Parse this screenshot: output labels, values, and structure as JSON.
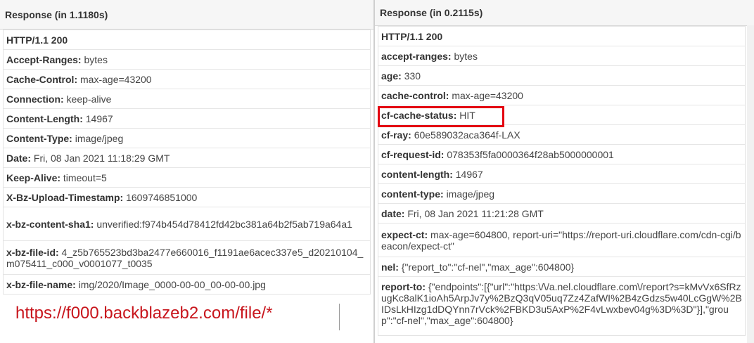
{
  "left": {
    "title": "Response (in 1.1180s)",
    "status": "HTTP/1.1 200",
    "headers": [
      {
        "key": "Accept-Ranges:",
        "value": "bytes"
      },
      {
        "key": "Cache-Control:",
        "value": "max-age=43200"
      },
      {
        "key": "Connection:",
        "value": "keep-alive"
      },
      {
        "key": "Content-Length:",
        "value": "14967"
      },
      {
        "key": "Content-Type:",
        "value": "image/jpeg"
      },
      {
        "key": "Date:",
        "value": "Fri, 08 Jan 2021 11:18:29 GMT"
      },
      {
        "key": "Keep-Alive:",
        "value": "timeout=5"
      },
      {
        "key": "X-Bz-Upload-Timestamp:",
        "value": "1609746851000"
      },
      {
        "key": "x-bz-content-sha1:",
        "value": "unverified:f974b454d78412fd42bc381a64b2f5ab719a64a1"
      },
      {
        "key": "x-bz-file-id:",
        "value": "4_z5b765523bd3ba2477e660016_f1191ae6acec337e5_d20210104_m075411_c000_v0001077_t0035"
      },
      {
        "key": "x-bz-file-name:",
        "value": "img/2020/Image_0000-00-00_00-00-00.jpg"
      }
    ]
  },
  "right": {
    "title": "Response (in 0.2115s)",
    "status": "HTTP/1.1 200",
    "headers": [
      {
        "key": "accept-ranges:",
        "value": "bytes"
      },
      {
        "key": "age:",
        "value": "330"
      },
      {
        "key": "cache-control:",
        "value": "max-age=43200"
      },
      {
        "key": "cf-cache-status:",
        "value": "HIT"
      },
      {
        "key": "cf-ray:",
        "value": "60e589032aca364f-LAX"
      },
      {
        "key": "cf-request-id:",
        "value": "078353f5fa0000364f28ab5000000001"
      },
      {
        "key": "content-length:",
        "value": "14967"
      },
      {
        "key": "content-type:",
        "value": "image/jpeg"
      },
      {
        "key": "date:",
        "value": "Fri, 08 Jan 2021 11:21:28 GMT"
      },
      {
        "key": "expect-ct:",
        "value": "max-age=604800, report-uri=\"https://report-uri.cloudflare.com/cdn-cgi/beacon/expect-ct\""
      },
      {
        "key": "nel:",
        "value": "{\"report_to\":\"cf-nel\",\"max_age\":604800}"
      },
      {
        "key": "report-to:",
        "value": "{\"endpoints\":[{\"url\":\"https:\\/\\/a.nel.cloudflare.com\\/report?s=kMvVx6SfRzugKc8alK1ioAh5ArpJv7y%2BzQ3qV05uq7Zz4ZafWI%2B4zGdzs5w40LcGgW%2BIDsLkHIzg1dDQYnn7rVck%2FBKD3u5AxP%2F4vLwxbev04g%3D%3D\"}],\"group\":\"cf-nel\",\"max_age\":604800}"
      }
    ]
  },
  "caption": "https://f000.backblazeb2.com/file/*",
  "colors": {
    "highlight": "#e3000f",
    "caption": "#c8161d"
  }
}
